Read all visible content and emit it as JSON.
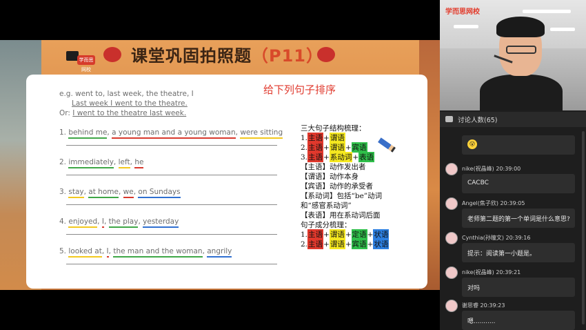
{
  "slide": {
    "title": "课堂巩固拍照题",
    "title_paren": "（P11）",
    "logo_text": "学而思网校",
    "heading": "给下列句子排序",
    "example": {
      "line1": "e.g. went to, last week, the theatre, I",
      "line2": "Last week I went to the theatre.",
      "line3_prefix": "Or:",
      "line3": "I went to the theatre last week."
    },
    "questions": [
      {
        "num": "1.",
        "segments": [
          {
            "text": "behind me",
            "color": "green"
          },
          {
            "text": ", ",
            "color": ""
          },
          {
            "text": "a young man and a young woman",
            "color": "red"
          },
          {
            "text": ", ",
            "color": ""
          },
          {
            "text": "were sitting",
            "color": "yellow"
          }
        ]
      },
      {
        "num": "2.",
        "segments": [
          {
            "text": "immediately",
            "color": "green"
          },
          {
            "text": ", ",
            "color": ""
          },
          {
            "text": "left",
            "color": "yellow"
          },
          {
            "text": ", ",
            "color": ""
          },
          {
            "text": "he",
            "color": "red"
          }
        ]
      },
      {
        "num": "3.",
        "segments": [
          {
            "text": "stay",
            "color": "yellow"
          },
          {
            "text": ", ",
            "color": ""
          },
          {
            "text": "at home",
            "color": "green"
          },
          {
            "text": ", ",
            "color": ""
          },
          {
            "text": "we",
            "color": "red"
          },
          {
            "text": ", ",
            "color": ""
          },
          {
            "text": "on Sundays",
            "color": "blue"
          }
        ]
      },
      {
        "num": "4.",
        "segments": [
          {
            "text": "enjoyed",
            "color": "yellow"
          },
          {
            "text": ", ",
            "color": ""
          },
          {
            "text": "I",
            "color": "red"
          },
          {
            "text": ", ",
            "color": ""
          },
          {
            "text": "the play",
            "color": "green"
          },
          {
            "text": ", ",
            "color": ""
          },
          {
            "text": "yesterday",
            "color": "blue"
          }
        ]
      },
      {
        "num": "5.",
        "segments": [
          {
            "text": "looked at",
            "color": "yellow"
          },
          {
            "text": ", ",
            "color": ""
          },
          {
            "text": "I",
            "color": "red"
          },
          {
            "text": ", ",
            "color": ""
          },
          {
            "text": "the man and the woman",
            "color": "green"
          },
          {
            "text": ", ",
            "color": ""
          },
          {
            "text": "angrily",
            "color": "blue"
          }
        ]
      }
    ],
    "notes": {
      "header": "三大句子结构梳理：",
      "structures": [
        {
          "num": "1.",
          "parts": [
            {
              "t": "主语",
              "c": "red"
            },
            {
              "t": "+",
              "c": ""
            },
            {
              "t": "谓语",
              "c": "yellow"
            }
          ]
        },
        {
          "num": "2.",
          "parts": [
            {
              "t": "主语",
              "c": "red"
            },
            {
              "t": "+",
              "c": ""
            },
            {
              "t": "谓语",
              "c": "yellow"
            },
            {
              "t": "+",
              "c": ""
            },
            {
              "t": "宾语",
              "c": "green"
            }
          ]
        },
        {
          "num": "3.",
          "parts": [
            {
              "t": "主语",
              "c": "red"
            },
            {
              "t": "+",
              "c": ""
            },
            {
              "t": "系动词",
              "c": "yellow"
            },
            {
              "t": "+",
              "c": ""
            },
            {
              "t": "表语",
              "c": "green"
            }
          ]
        }
      ],
      "defs": [
        "【主语】动作发出者",
        "【谓语】动作本身",
        "【宾语】动作的承受者",
        "【系动词】包括“be”动词",
        "和“感官系动词”",
        "【表语】用在系动词后面"
      ],
      "header2": "句子成分梳理：",
      "structures2": [
        {
          "num": "1.",
          "parts": [
            {
              "t": "主语",
              "c": "red"
            },
            {
              "t": "+",
              "c": ""
            },
            {
              "t": "谓语",
              "c": "yellow"
            },
            {
              "t": "+",
              "c": ""
            },
            {
              "t": "定语",
              "c": "green"
            },
            {
              "t": "+",
              "c": ""
            },
            {
              "t": "状语",
              "c": "blue"
            }
          ]
        },
        {
          "num": "2.",
          "parts": [
            {
              "t": "主语",
              "c": "red"
            },
            {
              "t": "+",
              "c": ""
            },
            {
              "t": "谓语",
              "c": "yellow"
            },
            {
              "t": "+",
              "c": ""
            },
            {
              "t": "宾语",
              "c": "green"
            },
            {
              "t": "+",
              "c": ""
            },
            {
              "t": "状语",
              "c": "blue"
            }
          ]
        }
      ]
    }
  },
  "panel": {
    "brand": "学而思网校",
    "chat_header": "讨论人数(65)",
    "messages": [
      {
        "name": "",
        "time": "",
        "text": "",
        "emoji": "😮"
      },
      {
        "name": "nike(祝晶峰)",
        "time": "20:39:00",
        "text": "CACBC"
      },
      {
        "name": "Angel(焦子欣)",
        "time": "20:39:05",
        "text": "老师第二题的第一个单词是什么意思?"
      },
      {
        "name": "Cynthia(孙瞳文)",
        "time": "20:39:16",
        "text": "提示：阅读第一小题是。"
      },
      {
        "name": "nike(祝晶峰)",
        "time": "20:39:21",
        "text": "对吗"
      },
      {
        "name": "谢思睿",
        "time": "20:39:23",
        "text": "嗯..........."
      }
    ]
  }
}
